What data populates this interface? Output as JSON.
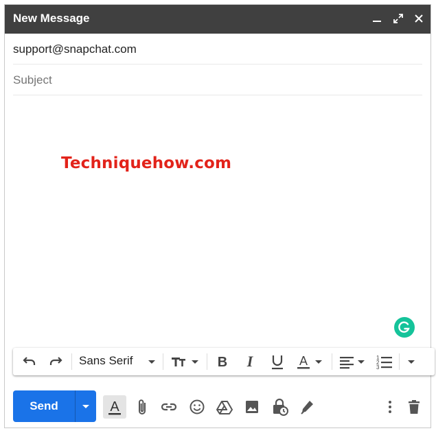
{
  "window": {
    "title": "New Message"
  },
  "recipients": {
    "value": "support@snapchat.com"
  },
  "subject": {
    "placeholder": "Subject",
    "value": ""
  },
  "body": {
    "watermark": "Techniquehow.com"
  },
  "formatting": {
    "font_name": "Sans Serif"
  },
  "actions": {
    "send_label": "Send"
  },
  "colors": {
    "titlebar": "#404040",
    "send": "#1a73e8",
    "watermark": "#e2231a",
    "grammarly": "#15c39a"
  },
  "icons": [
    "minimize-icon",
    "expand-icon",
    "close-icon",
    "undo-icon",
    "redo-icon",
    "text-size-icon",
    "bold-icon",
    "italic-icon",
    "underline-icon",
    "text-color-icon",
    "align-icon",
    "numbered-list-icon",
    "more-formatting-icon",
    "formatting-options-icon",
    "attach-icon",
    "link-icon",
    "emoji-icon",
    "drive-icon",
    "photo-icon",
    "confidential-mode-icon",
    "signature-icon",
    "more-options-icon",
    "discard-icon",
    "grammarly-icon"
  ]
}
